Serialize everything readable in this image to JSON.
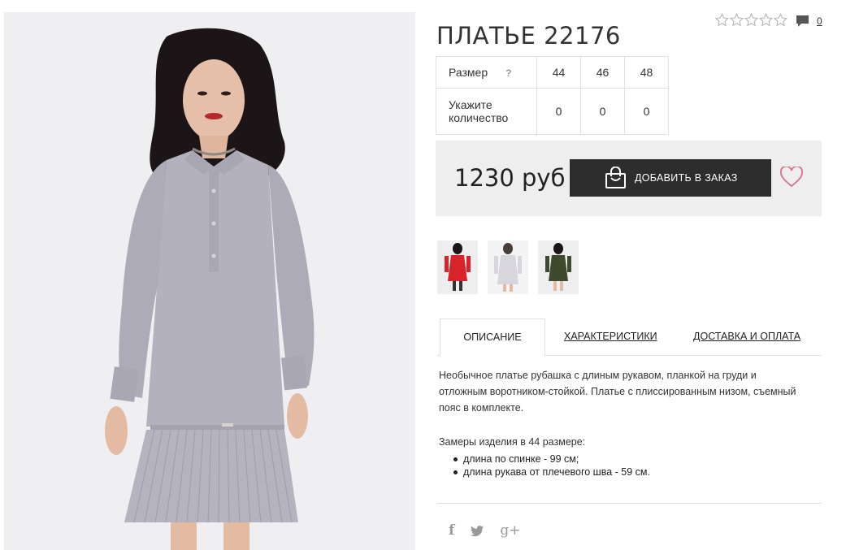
{
  "product": {
    "title": "ПЛАТЬЕ 22176",
    "rating_stars": 5,
    "rating_value": 0,
    "comments_count": "0",
    "price": "1230 руб",
    "add_to_order_label": "ДОБАВИТЬ В ЗАКАЗ"
  },
  "sizes": {
    "size_label": "Размер",
    "help_label": "?",
    "quantity_label_line1": "Укажите",
    "quantity_label_line2": "количество",
    "values": [
      "44",
      "46",
      "48"
    ],
    "quantities": [
      "0",
      "0",
      "0"
    ]
  },
  "tabs": {
    "description": "ОПИСАНИЕ",
    "specs": "ХАРАКТЕРИСТИКИ",
    "delivery": "ДОСТАВКА И ОПЛАТА"
  },
  "description": {
    "text": "Необычное платье рубашка с длиным рукавом, планкой на груди и отложным воротником-стойкой. Платье с плиссированным низом, съемный пояс в комплекте.",
    "measure_title": "Замеры изделия в 44 размере:",
    "measure_items": [
      "длина по спинке - 99 см;",
      "длина рукава от плечевого шва - 59 см."
    ]
  },
  "thumbnails": [
    {
      "color_name": "red",
      "hex": "#d9232b"
    },
    {
      "color_name": "grey",
      "hex": "#d8d6dc"
    },
    {
      "color_name": "olive",
      "hex": "#3e4a2e"
    }
  ],
  "colors": {
    "dress": "#b3b1bd",
    "button_bg": "#2d2d2d",
    "heart": "#d9798f",
    "buybox_bg": "#eeeeee"
  },
  "social": {
    "facebook": "f",
    "twitter": "t",
    "google_plus": "g+"
  }
}
